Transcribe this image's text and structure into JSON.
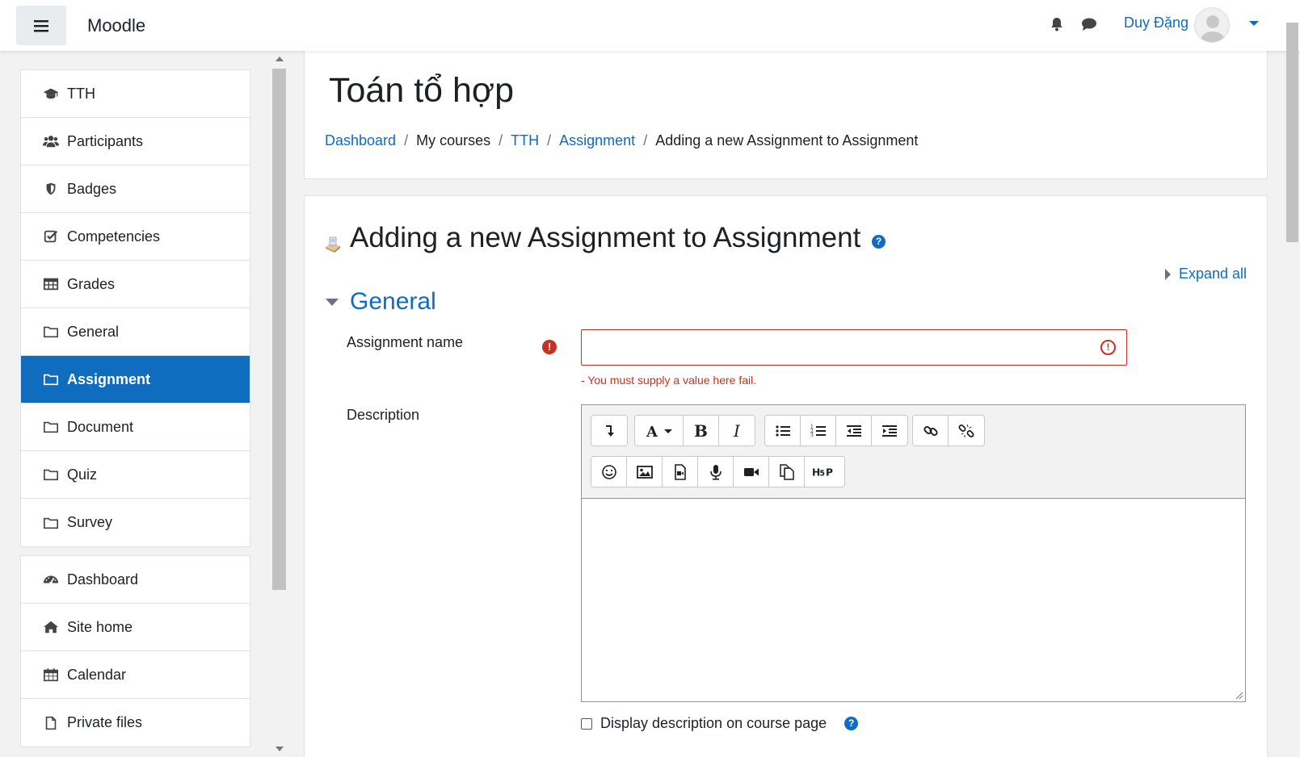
{
  "navbar": {
    "brand": "Moodle",
    "user_name": "Duy Đặng"
  },
  "drawer": {
    "course_items": [
      {
        "label": "TTH",
        "icon": "graduation-cap-icon"
      },
      {
        "label": "Participants",
        "icon": "users-icon"
      },
      {
        "label": "Badges",
        "icon": "shield-icon"
      },
      {
        "label": "Competencies",
        "icon": "check-square-icon"
      },
      {
        "label": "Grades",
        "icon": "table-icon"
      },
      {
        "label": "General",
        "icon": "folder-icon"
      },
      {
        "label": "Assignment",
        "icon": "folder-icon",
        "active": true
      },
      {
        "label": "Document",
        "icon": "folder-icon"
      },
      {
        "label": "Quiz",
        "icon": "folder-icon"
      },
      {
        "label": "Survey",
        "icon": "folder-icon"
      }
    ],
    "site_items": [
      {
        "label": "Dashboard",
        "icon": "tachometer-icon"
      },
      {
        "label": "Site home",
        "icon": "home-icon"
      },
      {
        "label": "Calendar",
        "icon": "calendar-icon"
      },
      {
        "label": "Private files",
        "icon": "file-icon"
      }
    ]
  },
  "header": {
    "title": "Toán tổ hợp",
    "breadcrumb": [
      {
        "label": "Dashboard",
        "link": true
      },
      {
        "label": "My courses",
        "link": false
      },
      {
        "label": "TTH",
        "link": true
      },
      {
        "label": "Assignment",
        "link": true
      },
      {
        "label": "Adding a new Assignment to Assignment",
        "link": false
      }
    ]
  },
  "form": {
    "title": "Adding a new Assignment to Assignment",
    "expand_all": "Expand all",
    "section_general": "General",
    "assignment_name_label": "Assignment name",
    "assignment_name_value": "",
    "assignment_name_error": "- You must supply a value here fail.",
    "description_label": "Description",
    "display_description_label": "Display description on course page",
    "display_description_checked": false
  },
  "colors": {
    "primary": "#0f6cbf",
    "danger": "#ca3120"
  }
}
